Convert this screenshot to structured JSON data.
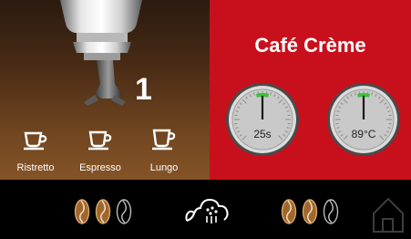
{
  "brew": {
    "cup_count": "1",
    "options": [
      {
        "label": "Ristretto",
        "icon": "cup-small-icon"
      },
      {
        "label": "Espresso",
        "icon": "cup-medium-icon"
      },
      {
        "label": "Lungo",
        "icon": "cup-large-icon"
      }
    ]
  },
  "drink": {
    "title": "Café Crème",
    "gauges": [
      {
        "name": "time-gauge",
        "value": "25s",
        "level": 0.5
      },
      {
        "name": "temperature-gauge",
        "value": "89°C",
        "level": 0.5
      }
    ]
  },
  "bottom_bar": {
    "left_beans": {
      "icon": "coffee-bean-strength-icon",
      "filled": 2,
      "total": 3
    },
    "steam": {
      "icon": "steam-cloud-icon"
    },
    "right_beans": {
      "icon": "coffee-bean-strength-icon",
      "filled": 2,
      "total": 3
    },
    "home": {
      "icon": "home-icon"
    }
  },
  "colors": {
    "accent_red": "#c8101c",
    "gauge_indicator": "#35c435"
  }
}
